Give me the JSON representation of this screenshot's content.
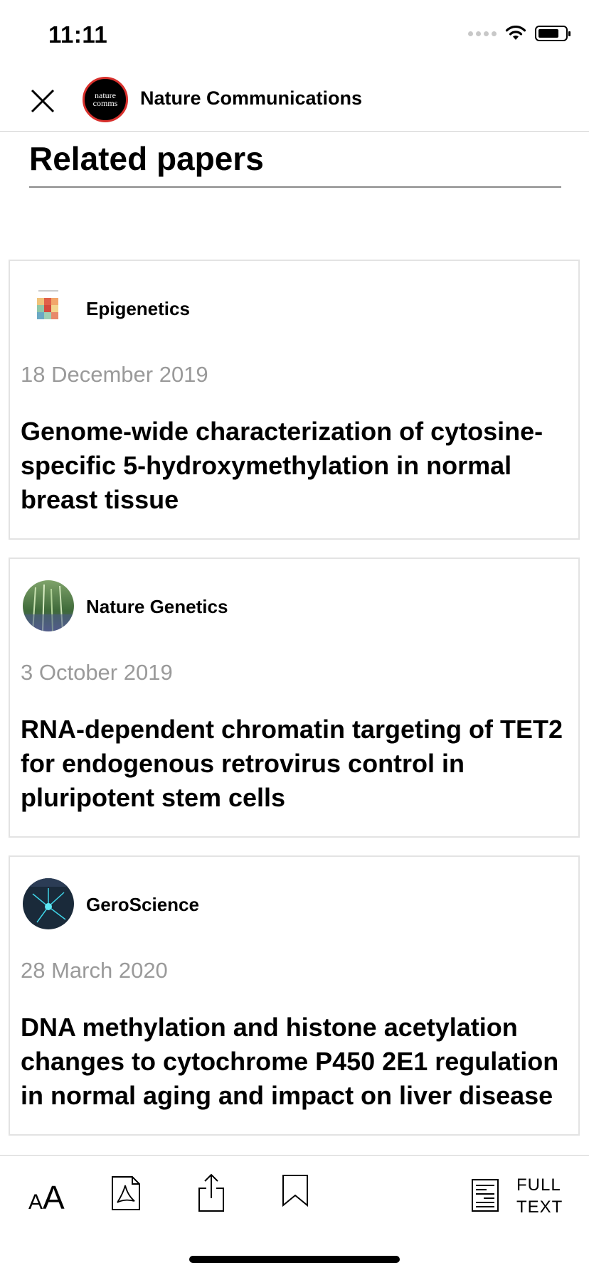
{
  "status": {
    "time": "11:11"
  },
  "header": {
    "logo_line1": "nature",
    "logo_line2": "comms",
    "journal_title": "Nature Communications"
  },
  "section": {
    "title": "Related papers"
  },
  "papers": [
    {
      "source": "Epigenetics",
      "date": "18 December 2019",
      "title": "Genome-wide characterization of cytosine-specific 5-hydroxymethylation in normal breast tissue"
    },
    {
      "source": "Nature Genetics",
      "date": "3 October 2019",
      "title": "RNA-dependent chromatin targeting of TET2 for endogenous retrovirus control in pluripotent stem cells"
    },
    {
      "source": "GeroScience",
      "date": "28 March 2020",
      "title": "DNA methylation and histone acetylation changes to cytochrome P450 2E1 regulation in normal aging and impact on liver disease"
    }
  ],
  "toolbar": {
    "font_small": "A",
    "font_big": "A",
    "fulltext_line1": "FULL",
    "fulltext_line2": "TEXT",
    "icons": [
      "font-size-icon",
      "pdf-icon",
      "share-icon",
      "bookmark-icon",
      "full-text-icon"
    ]
  },
  "colors": {
    "logo_ring": "#d8312d",
    "date_gray": "#9a9a9a",
    "divider": "#cfcfcf",
    "card_border": "#e3e3e3"
  }
}
